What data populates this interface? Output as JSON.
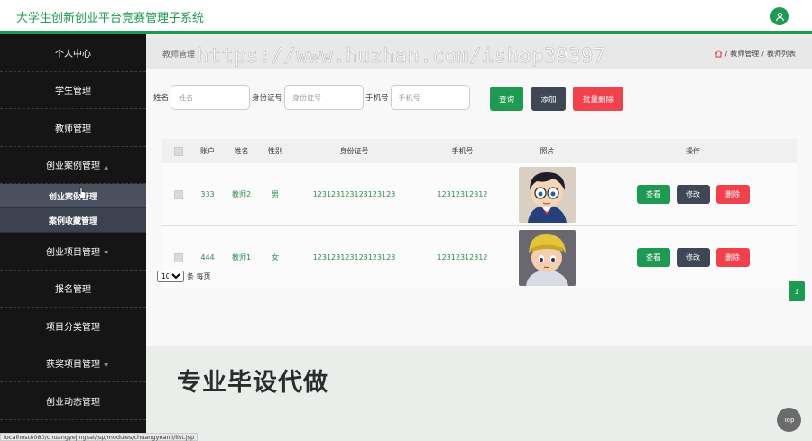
{
  "header": {
    "title": "大学生创新创业平台竞赛管理子系统",
    "user_icon": "user-icon"
  },
  "sidebar": {
    "items": [
      {
        "label": "个人中心"
      },
      {
        "label": "学生管理"
      },
      {
        "label": "教师管理"
      },
      {
        "label": "创业案例管理"
      },
      {
        "label": "创业项目管理"
      },
      {
        "label": "报名管理"
      },
      {
        "label": "项目分类管理"
      },
      {
        "label": "获奖项目管理"
      },
      {
        "label": "创业动态管理"
      }
    ],
    "subitems": [
      {
        "label": "创业案例管理"
      },
      {
        "label": "案例收藏管理"
      }
    ]
  },
  "breadcrumb": {
    "title": "教师管理",
    "path1": "教师管理",
    "separator": "/",
    "path2": "教师列表"
  },
  "search": {
    "name_label": "姓名",
    "name_placeholder": "姓名",
    "id_label": "身份证号",
    "id_placeholder": "身份证号",
    "phone_label": "手机号",
    "phone_placeholder": "手机号",
    "query_label": "查询",
    "add_label": "添加",
    "batch_delete_label": "批量删除"
  },
  "table": {
    "headers": [
      "账户",
      "姓名",
      "性别",
      "身份证号",
      "手机号",
      "照片",
      "操作"
    ],
    "rows": [
      {
        "account": "333",
        "name": "教师2",
        "gender": "男",
        "id_number": "123123123123123123",
        "phone": "12312312312"
      },
      {
        "account": "444",
        "name": "教师1",
        "gender": "女",
        "id_number": "123123123123123123",
        "phone": "12312312312"
      }
    ],
    "view_label": "查看",
    "edit_label": "修改",
    "delete_label": "删除"
  },
  "pagination": {
    "page_size": "10",
    "page_size_suffix": "条 每页",
    "current_page": "1"
  },
  "promo_text": "专业毕设代做",
  "watermark": "https://www.huzhan.com/ishop39397",
  "top_button": "Top",
  "status_url": "localhost8080/chuangyejingsai/jsp/modules/chuangyeanli/list.jsp",
  "colors": {
    "green": "#1f9a52",
    "slate": "#3f4756",
    "red": "#f0424d"
  }
}
